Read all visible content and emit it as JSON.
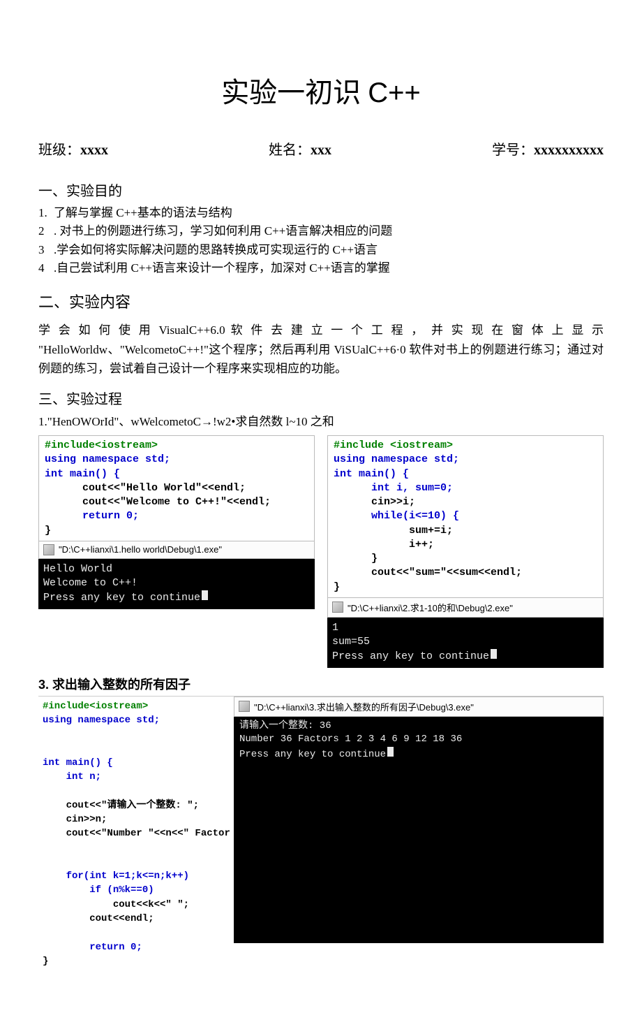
{
  "title_cn": "实验一初识 ",
  "title_cpp": "C++",
  "info": {
    "class_label": "班级：",
    "class_value": "xxxx",
    "name_label": "姓名：",
    "name_value": "xxx",
    "id_label": "学号：",
    "id_value": "xxxxxxxxxx"
  },
  "sec1_h": "一、实验目的",
  "sec1_items": [
    {
      "n": "1.",
      "t": "了解与掌握 C++基本的语法与结构"
    },
    {
      "n": "2",
      "t": " . 对书上的例题进行练习，学习如何利用 C++语言解决相应的问题"
    },
    {
      "n": "3",
      "t": " .学会如何将实际解决问题的思路转换成可实现运行的 C++语言"
    },
    {
      "n": "4",
      "t": " .自己尝试利用 C++语言来设计一个程序，加深对 C++语言的掌握"
    }
  ],
  "sec2_h": "二、实验内容",
  "sec2_body": "学 会 如 何 使 用 VisualC++6.0 软 件 去 建 立 一 个 工 程 ， 并 实 现 在 窗 体 上 显 示 \"HelloWorldw、\"WelcometoC++!\"这个程序；然后再利用 ViSUalC++6·0 软件对书上的例题进行练习；通过对例题的练习，尝试着自己设计一个程序来实现相应的功能。",
  "sec3_h": "三、实验过程",
  "sec3_sub1": "1.\"HenOWOrId\"、wWelcometoC→!w2•求自然数 l~10 之和",
  "code1_lines": [
    {
      "cls": "pre",
      "t": "#include<iostream>"
    },
    {
      "cls": "kw",
      "t": "using namespace std;"
    },
    {
      "cls": "kw",
      "t": "int main() {"
    },
    {
      "cls": "plain",
      "t": "      cout<<\"Hello World\"<<endl;"
    },
    {
      "cls": "plain",
      "t": "      cout<<\"Welcome to C++!\"<<endl;"
    },
    {
      "cls": "kw",
      "t": "      return 0;"
    },
    {
      "cls": "plain",
      "t": "}"
    }
  ],
  "tb1": "\"D:\\C++lianxi\\1.hello world\\Debug\\1.exe\"",
  "console1": "Hello World\nWelcome to C++!\nPress any key to continue",
  "code2_lines": [
    {
      "cls": "pre",
      "t": "#include <iostream>"
    },
    {
      "cls": "kw",
      "t": "using namespace std;"
    },
    {
      "cls": "kw",
      "t": "int main() {"
    },
    {
      "cls": "kw",
      "t": "      int i, sum=0;"
    },
    {
      "cls": "plain",
      "t": "      cin>>i;"
    },
    {
      "cls": "kw",
      "t": "      while(i<=10) {"
    },
    {
      "cls": "plain",
      "t": "            sum+=i;"
    },
    {
      "cls": "plain",
      "t": "            i++;"
    },
    {
      "cls": "plain",
      "t": "      }"
    },
    {
      "cls": "plain",
      "t": "      cout<<\"sum=\"<<sum<<endl;"
    },
    {
      "cls": "plain",
      "t": "}"
    }
  ],
  "tb2": "\"D:\\C++lianxi\\2.求1-10的和\\Debug\\2.exe\"",
  "console2": "1\nsum=55\nPress any key to continue",
  "sub3_head": "3. 求出输入整数的所有因子",
  "code3_lines": [
    {
      "cls": "pre",
      "t": "#include<iostream>"
    },
    {
      "cls": "kw",
      "t": "using namespace std;"
    },
    {
      "cls": "plain",
      "t": ""
    },
    {
      "cls": "plain",
      "t": ""
    },
    {
      "cls": "kw",
      "t": "int main() {"
    },
    {
      "cls": "kw",
      "t": "    int n;"
    },
    {
      "cls": "plain",
      "t": ""
    },
    {
      "cls": "plain",
      "t": "    cout<<\"请输入一个整数: \";"
    },
    {
      "cls": "plain",
      "t": "    cin>>n;"
    },
    {
      "cls": "plain",
      "t": "    cout<<\"Number \"<<n<<\" Factor"
    },
    {
      "cls": "plain",
      "t": ""
    },
    {
      "cls": "plain",
      "t": ""
    },
    {
      "cls": "kw",
      "t": "    for(int k=1;k<=n;k++)"
    },
    {
      "cls": "kw",
      "t": "        if (n%k==0)"
    },
    {
      "cls": "plain",
      "t": "            cout<<k<<\" \";"
    },
    {
      "cls": "plain",
      "t": "        cout<<endl;"
    },
    {
      "cls": "plain",
      "t": ""
    },
    {
      "cls": "kw",
      "t": "        return 0;"
    },
    {
      "cls": "plain",
      "t": "}"
    }
  ],
  "tb3": "\"D:\\C++lianxi\\3.求出输入整数的所有因子\\Debug\\3.exe\"",
  "console3": "请输入一个整数: 36\nNumber 36 Factors 1 2 3 4 6 9 12 18 36\nPress any key to continue"
}
